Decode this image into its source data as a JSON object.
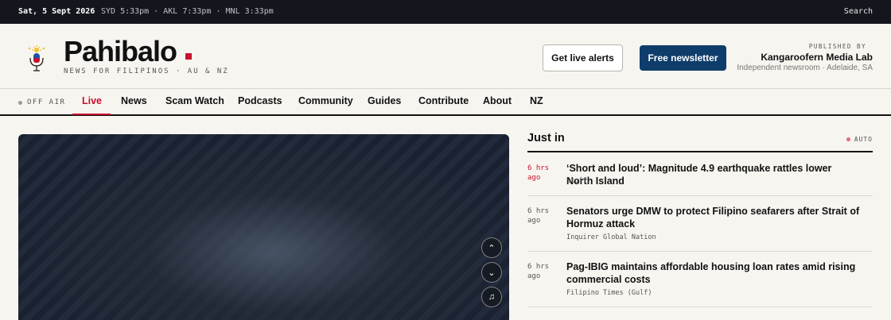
{
  "topbar": {
    "date": "Sat, 5 Sept 2026",
    "times": "SYD 5:33pm · AKL 7:33pm · MNL 3:33pm",
    "search_label": "Search"
  },
  "header": {
    "brand": "Pahibalo",
    "tagline": "NEWS FOR FILIPINOS · AU & NZ",
    "alerts_button": "Get live alerts",
    "newsletter_button": "Free newsletter",
    "published_by_label": "PUBLISHED BY",
    "publisher": "Kangaroofern Media Lab",
    "publisher_sub": "Independent newsroom · Adelaide, SA",
    "brand_accent_color": "#c8102e",
    "newsletter_color": "#0f3d6b"
  },
  "nav": {
    "status": "OFF AIR",
    "items": [
      {
        "label": "Live",
        "active": true
      },
      {
        "label": "News"
      },
      {
        "label": "Scam Watch"
      },
      {
        "label": "Podcasts"
      },
      {
        "label": "Community"
      },
      {
        "label": "Guides"
      },
      {
        "label": "Contribute"
      },
      {
        "label": "About"
      },
      {
        "label": "NZ"
      }
    ]
  },
  "player": {
    "controls": [
      {
        "icon": "chevron-up-icon",
        "glyph": "⌃"
      },
      {
        "icon": "chevron-down-icon",
        "glyph": "⌄"
      },
      {
        "icon": "music-note-icon",
        "glyph": "♫"
      }
    ]
  },
  "just_in": {
    "title": "Just in",
    "auto_label": "AUTO",
    "stories": [
      {
        "time": "6 hrs ago",
        "headline": "‘Short and loud’: Magnitude 4.9 earthquake rattles lower North Island",
        "source": "Stuff"
      },
      {
        "time": "6 hrs ago",
        "headline": "Senators urge DMW to protect Filipino seafarers after Strait of Hormuz attack",
        "source": "Inquirer Global Nation"
      },
      {
        "time": "6 hrs ago",
        "headline": "Pag-IBIG maintains affordable housing loan rates amid rising commercial costs",
        "source": "Filipino Times (Gulf)"
      }
    ]
  }
}
